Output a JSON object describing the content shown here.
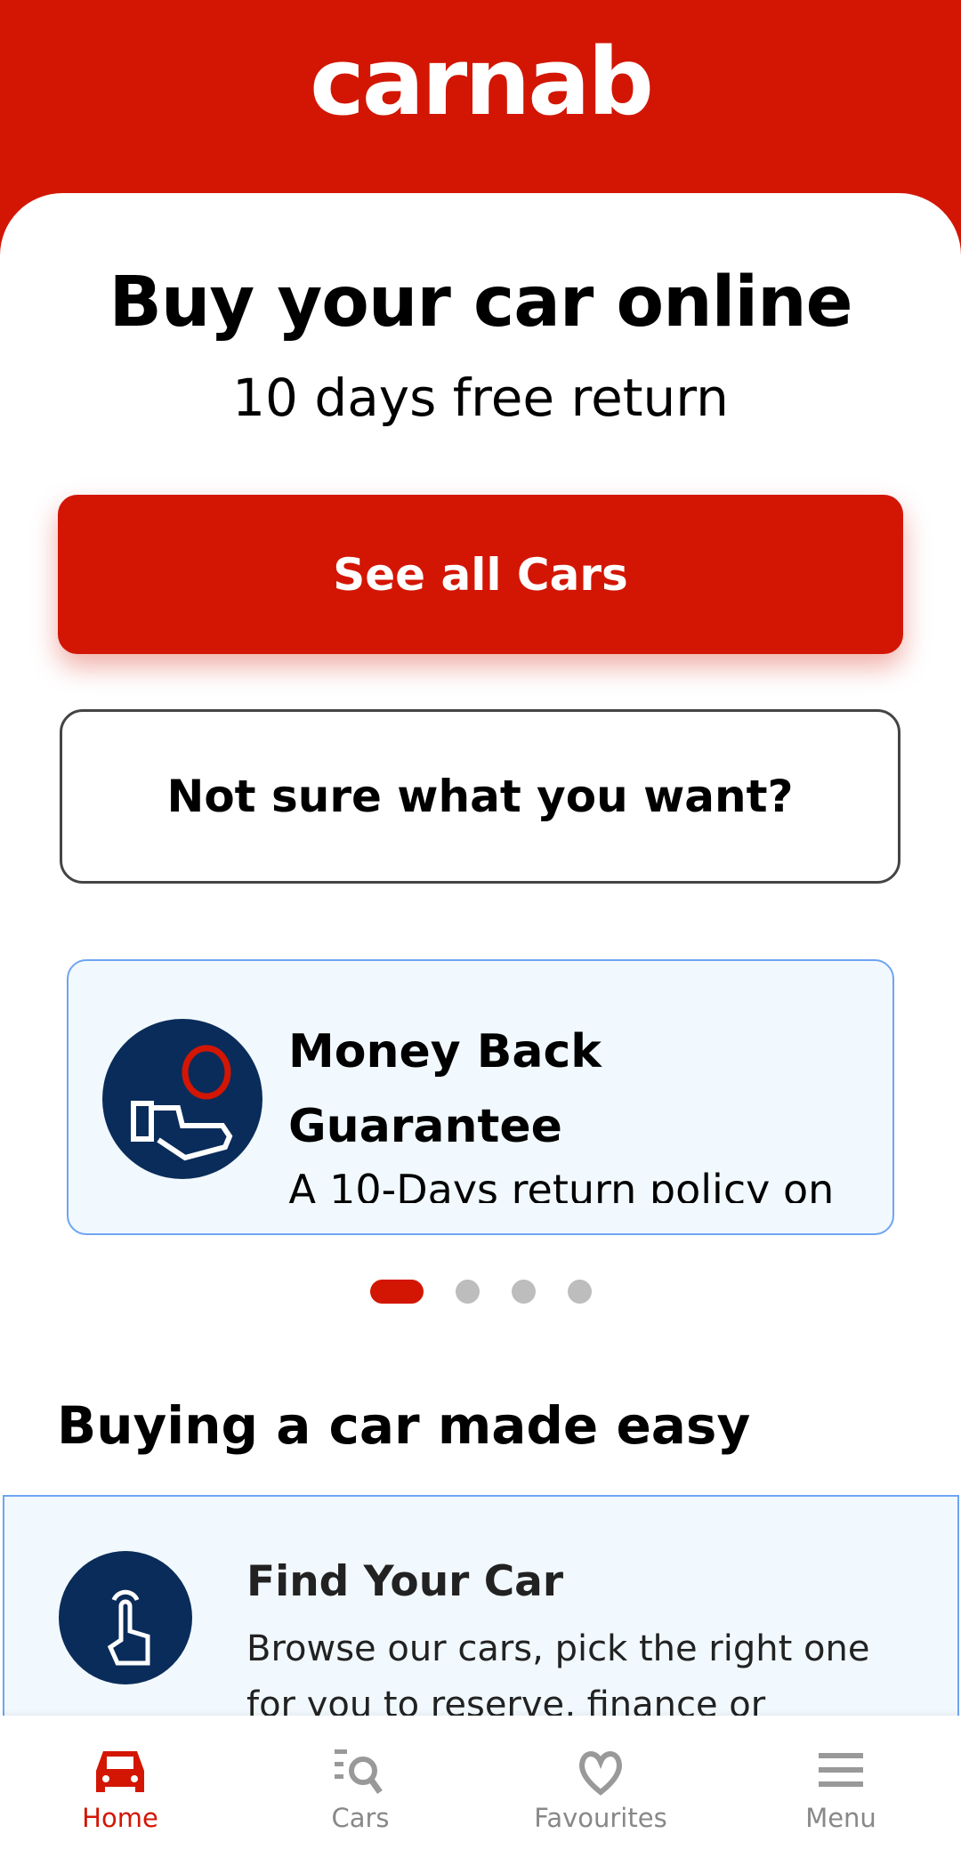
{
  "header": {
    "logo": "carnab"
  },
  "hero": {
    "title": "Buy your car online",
    "subtitle": "10 days free return"
  },
  "buttons": {
    "see_all": "See all Cars",
    "not_sure": "Not sure what you want?"
  },
  "promo": {
    "title": "Money Back Guarantee",
    "description": "A 10-Days return policy on",
    "icon": "hand-coin-icon",
    "active_slide": 1,
    "slide_count": 4
  },
  "section": {
    "title": "Buying a car made easy"
  },
  "step": {
    "title": "Find Your Car",
    "description": "Browse our cars, pick the right one for you to reserve, finance or",
    "icon": "tap-finger-icon"
  },
  "nav": {
    "items": [
      {
        "label": "Home",
        "icon": "car-icon",
        "active": true
      },
      {
        "label": "Cars",
        "icon": "search-list-icon"
      },
      {
        "label": "Favourites",
        "icon": "heart-icon"
      },
      {
        "label": "Menu",
        "icon": "hamburger-icon"
      }
    ]
  },
  "colors": {
    "brand": "#d31604",
    "navy": "#0a2c5a",
    "card_bg": "#f1f9fe",
    "card_border": "#6fa4f2"
  }
}
